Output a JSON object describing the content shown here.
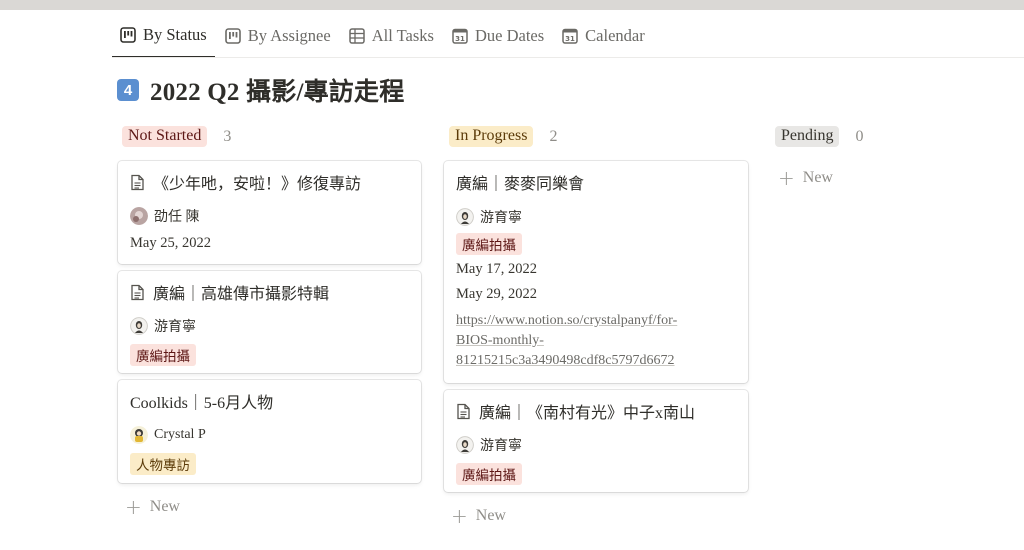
{
  "tabs": [
    {
      "label": "By Status",
      "icon": "board-icon",
      "active": true
    },
    {
      "label": "By Assignee",
      "icon": "board-icon",
      "active": false
    },
    {
      "label": "All Tasks",
      "icon": "table-icon",
      "active": false
    },
    {
      "label": "Due Dates",
      "icon": "calendar-31-icon",
      "active": false
    },
    {
      "label": "Calendar",
      "icon": "calendar-31-icon",
      "active": false
    }
  ],
  "page": {
    "emoji": "4",
    "title": "2022 Q2  攝影/專訪走程"
  },
  "colors": {
    "not_started_bg": "#fbe2dd",
    "in_progress_bg": "#fbecc8",
    "pending_bg": "#e8e7e5",
    "tag_red_bg": "#fbe2dd",
    "tag_yellow_bg": "#fbecc8"
  },
  "columns": [
    {
      "label": "Not Started",
      "count": "3",
      "new_label": "New",
      "cards": [
        {
          "title": "《少年吔，安啦！》修復專訪",
          "has_doc_icon": true,
          "person": "劭任 陳",
          "date": "May 25, 2022"
        },
        {
          "title": "廣編｜高雄傳市攝影特輯",
          "has_doc_icon": true,
          "person": "游育寧",
          "tag": "廣編拍攝"
        },
        {
          "title": "Coolkids｜5-6月人物",
          "has_doc_icon": false,
          "person": "Crystal P",
          "tag": "人物專訪"
        }
      ]
    },
    {
      "label": "In Progress",
      "count": "2",
      "new_label": "New",
      "cards": [
        {
          "title": "廣編｜麥麥同樂會",
          "has_doc_icon": false,
          "person": "游育寧",
          "tag": "廣編拍攝",
          "date1": "May 17, 2022",
          "date2": "May 29, 2022",
          "url_lines": [
            "https://www.notion.so/crystalpanyf/for-",
            "BIOS-monthly-",
            "81215215c3a3490498cdf8c5797d6672"
          ]
        },
        {
          "title": "廣編｜《南村有光》中子x南山",
          "has_doc_icon": true,
          "person": "游育寧",
          "tag": "廣編拍攝"
        }
      ]
    },
    {
      "label": "Pending",
      "count": "0",
      "new_label": "New",
      "cards": []
    }
  ]
}
